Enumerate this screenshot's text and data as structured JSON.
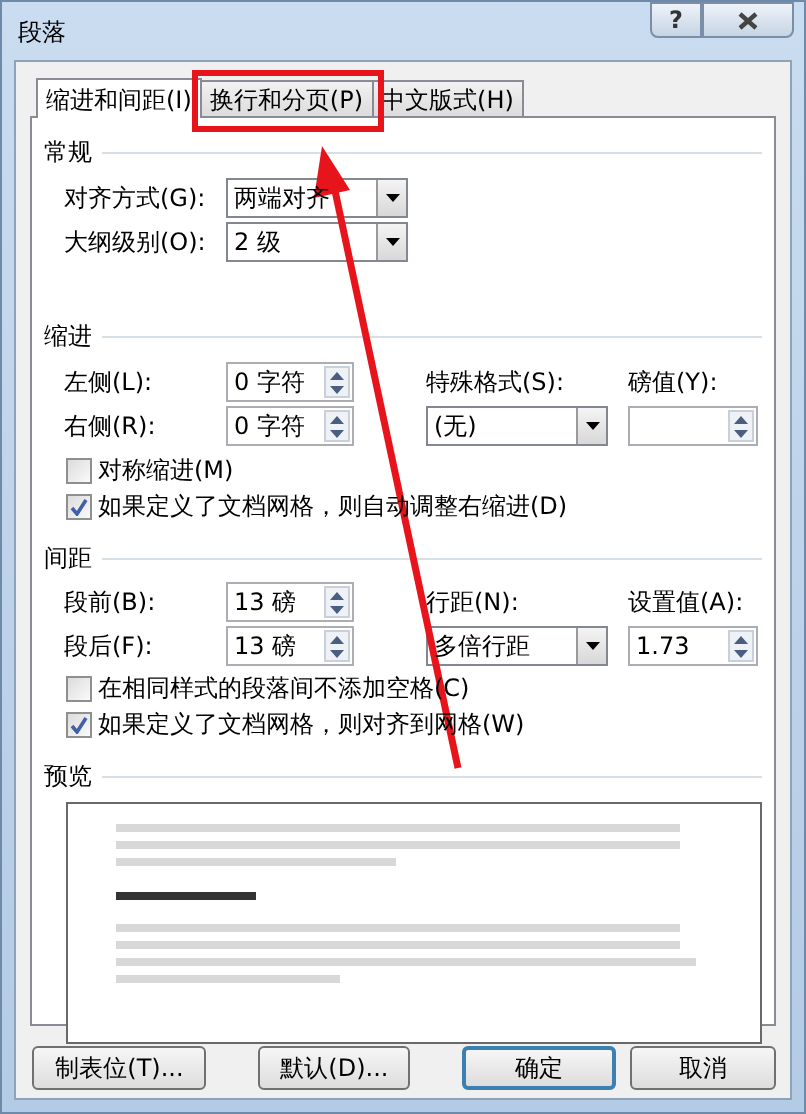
{
  "window": {
    "title": "段落",
    "help": "?"
  },
  "tabs": [
    {
      "label": "缩进和间距(I)",
      "selected": true
    },
    {
      "label": "换行和分页(P)",
      "selected": false
    },
    {
      "label": "中文版式(H)",
      "selected": false
    }
  ],
  "general": {
    "title": "常规",
    "rows": [
      {
        "label": "对齐方式(G):",
        "value": "两端对齐",
        "kind": "dropdown"
      },
      {
        "label": "大纲级别(O):",
        "value": "2 级",
        "kind": "dropdown"
      }
    ]
  },
  "indent": {
    "title": "缩进",
    "left": {
      "label": "左侧(L):",
      "value": "0 字符"
    },
    "right": {
      "label": "右侧(R):",
      "value": "0 字符"
    },
    "special": {
      "label": "特殊格式(S):",
      "value": "(无)"
    },
    "by": {
      "label": "磅值(Y):"
    },
    "checks": [
      {
        "label": "对称缩进(M)",
        "checked": false
      },
      {
        "label": "如果定义了文档网格，则自动调整右缩进(D)",
        "checked": true
      }
    ]
  },
  "spacing": {
    "title": "间距",
    "before": {
      "label": "段前(B):",
      "value": "13 磅"
    },
    "after": {
      "label": "段后(F):",
      "value": "13 磅"
    },
    "line": {
      "label": "行距(N):",
      "value": "多倍行距"
    },
    "at": {
      "label": "设置值(A):",
      "value": "1.73"
    },
    "checks": [
      {
        "label": "在相同样式的段落间不添加空格(C)",
        "checked": false
      },
      {
        "label": "如果定义了文档网格，则对齐到网格(W)",
        "checked": true
      }
    ]
  },
  "preview": {
    "title": "预览"
  },
  "buttons": [
    {
      "label": "制表位(T)...",
      "default": false
    },
    {
      "label": "默认(D)...",
      "default": false
    },
    {
      "label": "确定",
      "default": true
    },
    {
      "label": "取消",
      "default": false
    }
  ]
}
